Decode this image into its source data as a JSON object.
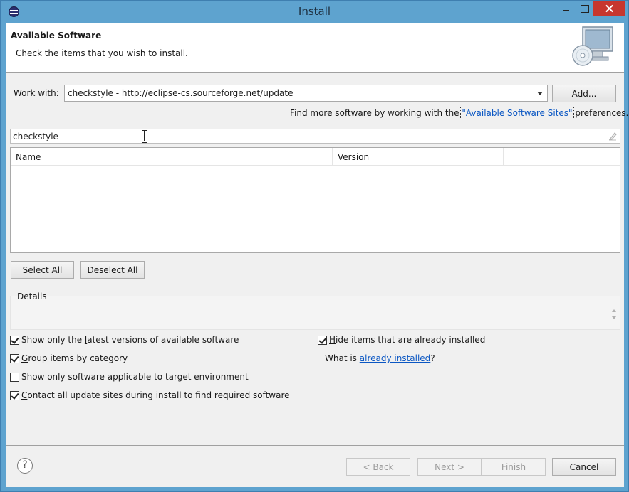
{
  "window": {
    "title": "Install"
  },
  "header": {
    "title": "Available Software",
    "description": "Check the items that you wish to install."
  },
  "work_with": {
    "label_mnemonic": "W",
    "label_rest": "ork with:",
    "value": "checkstyle - http://eclipse-cs.sourceforge.net/update",
    "add_button": "Add..."
  },
  "find_more": {
    "prefix": "Find more software by working with the ",
    "link": "\"Available Software Sites\"",
    "suffix": " preferences."
  },
  "filter": {
    "value": "checkstyle"
  },
  "table": {
    "columns": [
      "Name",
      "Version",
      ""
    ]
  },
  "buttons": {
    "select_all_mnemonic": "S",
    "select_all_rest": "elect All",
    "deselect_all_mnemonic": "D",
    "deselect_all_rest": "eselect All",
    "back": "< Back",
    "back_mnemonic": "B",
    "next": "Next >",
    "next_mnemonic": "N",
    "finish": "Finish",
    "finish_mnemonic": "F",
    "cancel": "Cancel"
  },
  "details": {
    "label": "Details"
  },
  "options": [
    {
      "pre": "Show only the ",
      "mn": "l",
      "post": "atest versions of available software",
      "checked": true
    },
    {
      "pre": "",
      "mn": "G",
      "post": "roup items by category",
      "checked": true
    },
    {
      "pre": "Show only software applicable to target environment",
      "mn": "",
      "post": "",
      "checked": false
    },
    {
      "pre": "",
      "mn": "C",
      "post": "ontact all update sites during install to find required software",
      "checked": true
    },
    {
      "pre": "",
      "mn": "H",
      "post": "ide items that are already installed",
      "checked": true
    }
  ],
  "what_is": {
    "prefix": "What is ",
    "link": "already installed",
    "suffix": "?"
  },
  "help": {
    "glyph": "?"
  }
}
